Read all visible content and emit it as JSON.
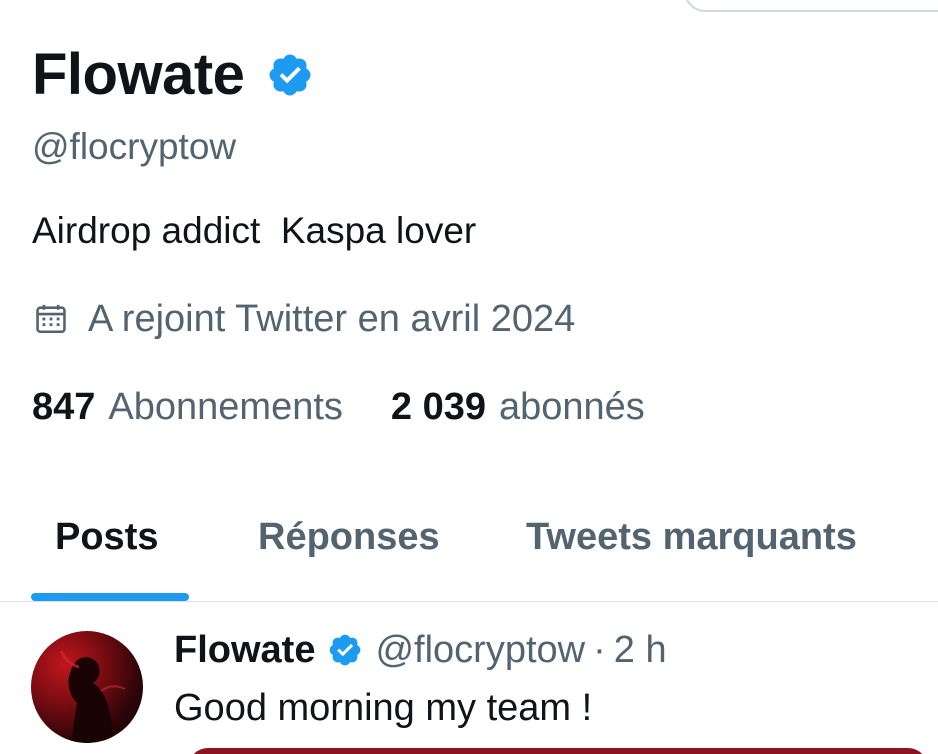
{
  "profile": {
    "display_name": "Flowate",
    "handle": "@flocryptow",
    "bio": "Airdrop addict  Kaspa lover",
    "joined": "A rejoint Twitter en avril 2024",
    "following_count": "847",
    "following_label": "Abonnements",
    "followers_count": "2 039",
    "followers_label": "abonnés"
  },
  "tabs": [
    {
      "label": "Posts",
      "active": true
    },
    {
      "label": "Réponses",
      "active": false
    },
    {
      "label": "Tweets marquants",
      "active": false
    }
  ],
  "post": {
    "author_name": "Flowate",
    "author_handle": "@flocryptow",
    "separator": "·",
    "time": "2 h",
    "text": "Good morning my team !"
  },
  "colors": {
    "accent": "#1d9bf0",
    "text_primary": "#0f1419",
    "text_secondary": "#536471"
  },
  "icons": [
    "verified-badge-icon",
    "calendar-icon"
  ]
}
